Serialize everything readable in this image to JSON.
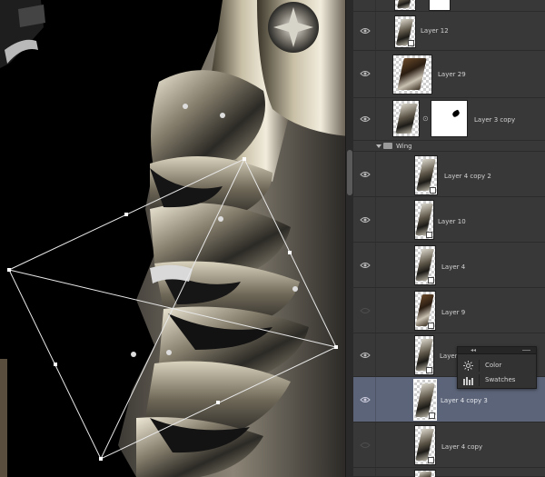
{
  "layers": [
    {
      "name": "",
      "visible": true
    },
    {
      "name": "Layer 12",
      "visible": true
    },
    {
      "name": "Layer 29",
      "visible": true
    },
    {
      "name": "Layer 3 copy",
      "visible": true,
      "has_mask": true
    },
    {
      "name": "Layer 4 copy 2",
      "visible": true
    },
    {
      "name": "Layer 10",
      "visible": true
    },
    {
      "name": "Layer 4",
      "visible": true
    },
    {
      "name": "Layer 9",
      "visible": false
    },
    {
      "name": "Layer 10",
      "visible": true
    },
    {
      "name": "Layer 4 copy 3",
      "visible": true,
      "selected": true
    },
    {
      "name": "Layer 4 copy",
      "visible": false
    }
  ],
  "group": {
    "name": "Wing",
    "expanded": true
  },
  "float_panel": {
    "items": [
      {
        "label": "Color",
        "icon": "color-palette-icon"
      },
      {
        "label": "Swatches",
        "icon": "swatches-grid-icon"
      }
    ]
  },
  "colors": {
    "panel_bg": "#383838",
    "selected_row": "#5b6478",
    "canvas_bg": "#000000"
  }
}
